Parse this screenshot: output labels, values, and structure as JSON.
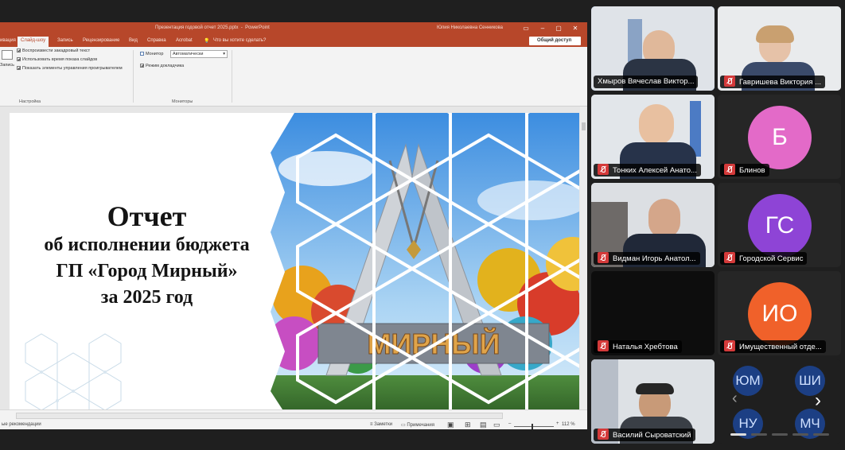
{
  "ppt": {
    "doc_title": "Презентация годовой отчет 2025.pptx",
    "app_name": "PowerPoint",
    "user": "Юлия Николаевна Сенникова",
    "tabs": [
      "Слайд-шоу",
      "Запись",
      "Рецензирование",
      "Вид",
      "Справка",
      "Acrobat"
    ],
    "tab_prefix": "ивация",
    "help_search": "Что вы хотите сделать?",
    "share_btn": "Общий доступ",
    "ribbon": {
      "record_label": "Запись",
      "chk1": "Воспроизвести закадровый текст",
      "chk2": "Использовать время показа слайдов",
      "chk3": "Показать элементы управления проигрывателем",
      "group1": "Настройка",
      "monitor_label": "Монитор",
      "monitor_value": "Автоматически",
      "presenter_view": "Режим докладчика",
      "group2": "Мониторы"
    },
    "status": {
      "left": "ые рекомендации",
      "notes": "Заметки",
      "comments": "Примечания",
      "zoom": "112 %"
    }
  },
  "slide": {
    "title": "Отчет",
    "line1": "об исполнении бюджета",
    "line2": "ГП «Город Мирный»",
    "line3": "за 2025 год",
    "sign_text": "МИРНЫЙ"
  },
  "participants": [
    {
      "name": "Хмыров Вячеслав Виктор...",
      "muted": false
    },
    {
      "name": "Гавришева Виктория ...",
      "muted": true
    },
    {
      "name": "Тонких Алексей Анато...",
      "muted": true
    },
    {
      "name": "Блинов",
      "initials": "Б",
      "color": "#e36ac8",
      "muted": true
    },
    {
      "name": "Видман Игорь Анатол...",
      "muted": true
    },
    {
      "name": "Городской Сервис",
      "initials": "ГС",
      "color": "#8e44d6",
      "muted": true
    },
    {
      "name": "Наталья Хребтова",
      "muted": true
    },
    {
      "name": "Имущественный отде...",
      "initials": "ИО",
      "color": "#f0612a",
      "muted": true
    },
    {
      "name": "Василий Сыроватский",
      "muted": true
    }
  ],
  "more_participants": [
    "ЮМ",
    "ШИ",
    "НУ",
    "МЧ"
  ]
}
